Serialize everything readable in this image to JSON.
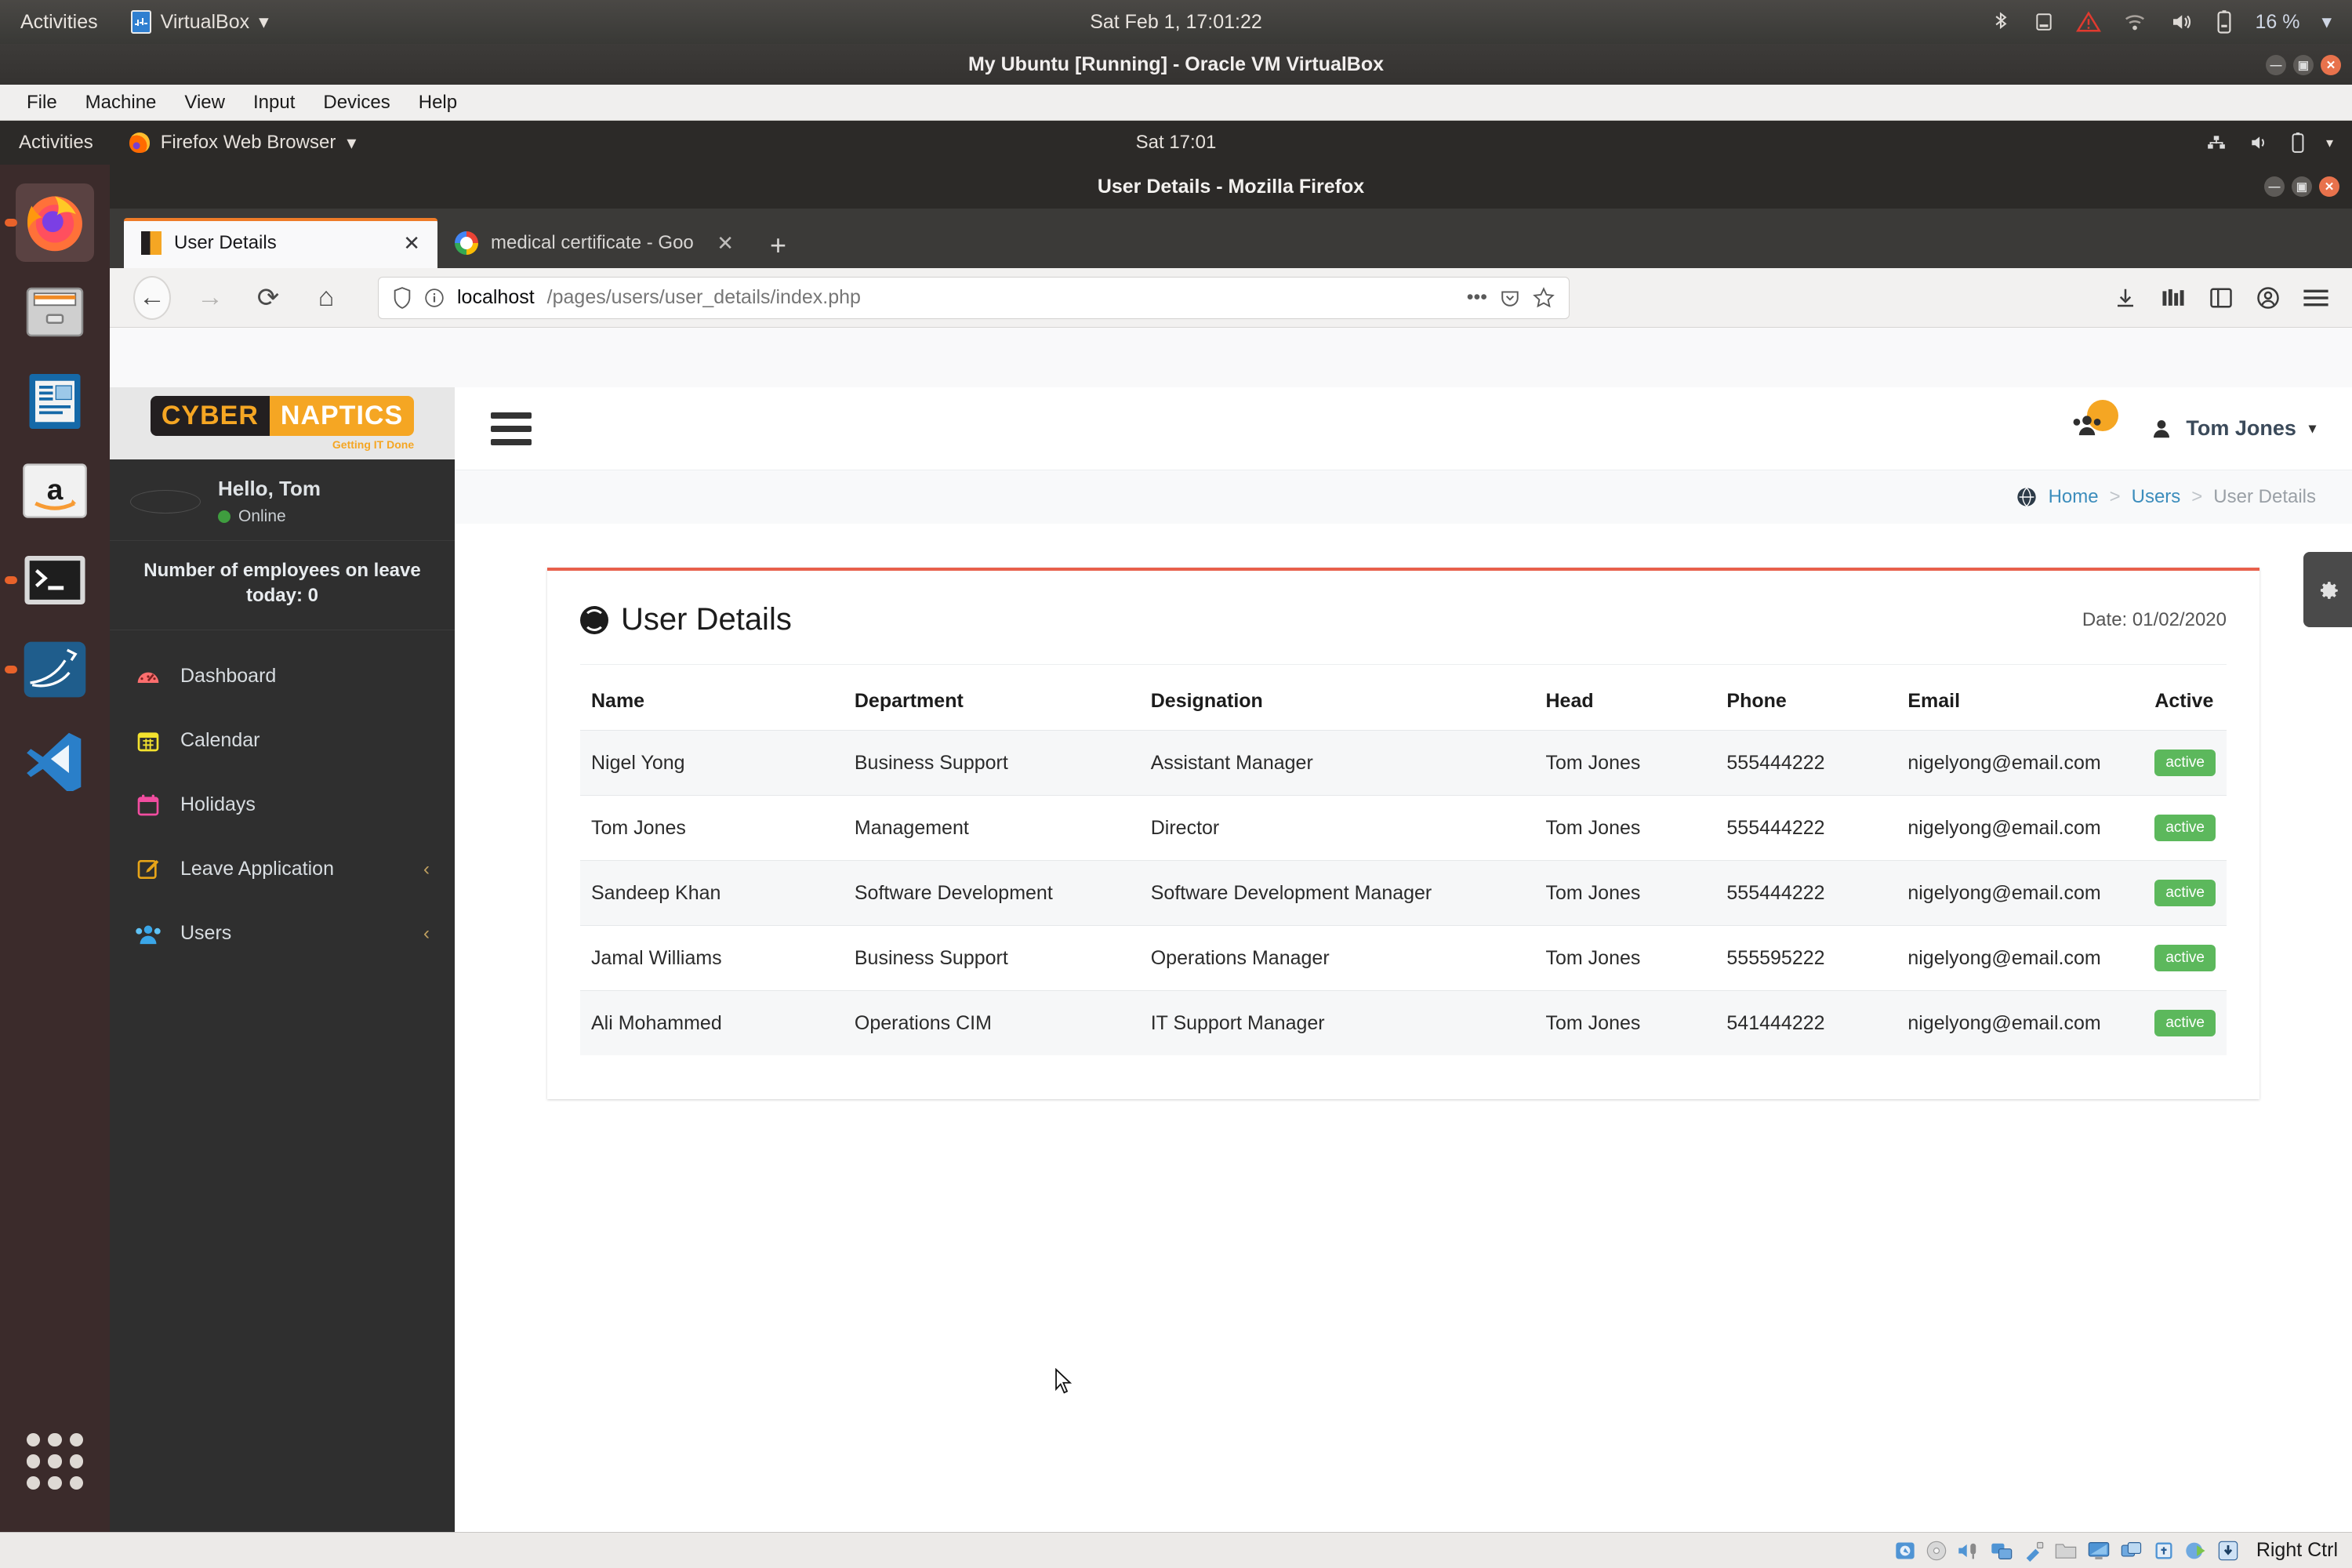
{
  "host_topbar": {
    "activities": "Activities",
    "app_menu": "VirtualBox",
    "app_caret": "▾",
    "clock": "Sat Feb  1, 17:01:22",
    "battery": "16 %",
    "tray_caret": "▾",
    "icons": [
      "bluetooth-icon",
      "notes-icon",
      "warning-icon",
      "wifi-icon",
      "volume-icon",
      "battery-icon"
    ]
  },
  "vbox_window": {
    "title": "My Ubuntu [Running] - Oracle VM VirtualBox",
    "minimize": "—",
    "maximize": "▣",
    "close": "✕",
    "menu": [
      "File",
      "Machine",
      "View",
      "Input",
      "Devices",
      "Help"
    ]
  },
  "guest_topbar": {
    "activities": "Activities",
    "app_menu": "Firefox Web Browser",
    "app_caret": "▾",
    "clock": "Sat 17:01",
    "icons": [
      "network-icon",
      "volume-icon",
      "battery-icon",
      "chevron-down-icon"
    ]
  },
  "dock": {
    "items": [
      {
        "name": "firefox",
        "glyph": "",
        "label": "Firefox"
      },
      {
        "name": "files",
        "glyph": "",
        "label": "Files"
      },
      {
        "name": "libreoffice-writer",
        "glyph": "",
        "label": "LibreOffice Writer"
      },
      {
        "name": "amazon",
        "glyph": "a",
        "label": "Amazon"
      },
      {
        "name": "terminal",
        "glyph": ">_",
        "label": "Terminal"
      },
      {
        "name": "mysql-workbench",
        "glyph": "",
        "label": "MySQL Workbench"
      },
      {
        "name": "vscode",
        "glyph": "",
        "label": "Visual Studio Code"
      }
    ],
    "show_apps": "Show Applications"
  },
  "firefox": {
    "window_title": "User Details - Mozilla Firefox",
    "minimize": "—",
    "maximize": "▣",
    "close": "✕",
    "tabs": [
      {
        "title": "User Details",
        "favicon": "userdetails-favicon",
        "close": "✕",
        "active": true
      },
      {
        "title": "medical certificate - Goo",
        "favicon": "google-favicon",
        "close": "✕",
        "active": false
      }
    ],
    "new_tab": "+",
    "nav": {
      "back": "←",
      "forward": "→",
      "reload": "⟳",
      "home": "⌂",
      "shield_icon": "shield-icon",
      "info_icon": "info-icon",
      "url_host": "localhost",
      "url_path": "/pages/users/user_details/index.php",
      "page_actions": "•••",
      "pocket_icon": "pocket-icon",
      "bookmark_icon": "star-icon",
      "downloads_icon": "download-icon",
      "library_icon": "library-icon",
      "sidebar_icon": "sidebar-icon",
      "account_icon": "account-icon",
      "menu_icon": "hamburger-icon"
    }
  },
  "app": {
    "logo": {
      "part1": "CYBER",
      "part2": "NAPTICS",
      "tagline": "Getting IT Done"
    },
    "user": {
      "greeting": "Hello, Tom",
      "status": "Online"
    },
    "leave_notice": "Number of employees on leave today: 0",
    "nav_items": [
      {
        "label": "Dashboard",
        "icon": "dashboard-icon",
        "glyph": "◉",
        "chevron": ""
      },
      {
        "label": "Calendar",
        "icon": "calendar-icon",
        "glyph": "▦",
        "chevron": ""
      },
      {
        "label": "Holidays",
        "icon": "holidays-icon",
        "glyph": "▤",
        "chevron": ""
      },
      {
        "label": "Leave Application",
        "icon": "leave-application-icon",
        "glyph": "✎",
        "chevron": "‹"
      },
      {
        "label": "Users",
        "icon": "users-icon",
        "glyph": "◍",
        "chevron": "‹"
      }
    ],
    "topnav": {
      "toggle": "menu-toggle",
      "group_icon": "group-users-icon",
      "username": "Tom Jones",
      "caret": "▾"
    },
    "breadcrumb": {
      "home": "Home",
      "sep": ">",
      "users": "Users",
      "current": "User Details"
    },
    "card": {
      "title": "User Details",
      "date": "Date: 01/02/2020",
      "columns": [
        "Name",
        "Department",
        "Designation",
        "Head",
        "Phone",
        "Email",
        "Active"
      ],
      "rows": [
        {
          "name": "Nigel Yong",
          "department": "Business Support",
          "designation": "Assistant Manager",
          "head": "Tom Jones",
          "phone": "555444222",
          "email": "nigelyong@email.com",
          "active": "active"
        },
        {
          "name": "Tom Jones",
          "department": "Management",
          "designation": "Director",
          "head": "Tom Jones",
          "phone": "555444222",
          "email": "nigelyong@email.com",
          "active": "active"
        },
        {
          "name": "Sandeep Khan",
          "department": "Software Development",
          "designation": "Software Development Manager",
          "head": "Tom Jones",
          "phone": "555444222",
          "email": "nigelyong@email.com",
          "active": "active"
        },
        {
          "name": "Jamal Williams",
          "department": "Business Support",
          "designation": "Operations Manager",
          "head": "Tom Jones",
          "phone": "555595222",
          "email": "nigelyong@email.com",
          "active": "active"
        },
        {
          "name": "Ali Mohammed",
          "department": "Operations CIM",
          "designation": "IT Support Manager",
          "head": "Tom Jones",
          "phone": "541444222",
          "email": "nigelyong@email.com",
          "active": "active"
        }
      ]
    },
    "settings_tab": "⚙"
  },
  "vbox_status": {
    "host_key": "Right Ctrl",
    "icons": [
      "hard-disk-icon",
      "optical-disk-icon",
      "audio-icon",
      "network-icon",
      "usb-icon",
      "shared-folders-icon",
      "display-icon",
      "recording-icon",
      "cpu-icon",
      "guest-additions-icon",
      "mouse-capture-icon"
    ]
  },
  "colors": {
    "accent_orange": "#f5a623",
    "card_accent": "#e8604c",
    "badge_green": "#5cb85c",
    "link_blue": "#3c8dbc",
    "sidebar_dark": "#2f2f2f"
  }
}
